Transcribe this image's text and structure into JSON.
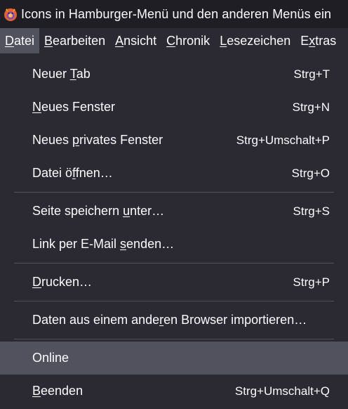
{
  "window": {
    "title": "Icons in Hamburger-Menü und den anderen Menüs ein"
  },
  "menubar": {
    "items": [
      {
        "pre": "",
        "ul": "D",
        "post": "atei",
        "active": true
      },
      {
        "pre": "",
        "ul": "B",
        "post": "earbeiten",
        "active": false
      },
      {
        "pre": "",
        "ul": "A",
        "post": "nsicht",
        "active": false
      },
      {
        "pre": "",
        "ul": "C",
        "post": "hronik",
        "active": false
      },
      {
        "pre": "",
        "ul": "L",
        "post": "esezeichen",
        "active": false
      },
      {
        "pre": "E",
        "ul": "x",
        "post": "tras",
        "active": false
      }
    ]
  },
  "menu": {
    "items": [
      {
        "pre": "Neuer ",
        "ul": "T",
        "post": "ab",
        "shortcut": "Strg+T"
      },
      {
        "pre": "",
        "ul": "N",
        "post": "eues Fenster",
        "shortcut": "Strg+N"
      },
      {
        "pre": "Neues ",
        "ul": "p",
        "post": "rivates Fenster",
        "shortcut": "Strg+Umschalt+P"
      },
      {
        "pre": "Datei ö",
        "ul": "f",
        "post": "fnen…",
        "shortcut": "Strg+O"
      },
      {
        "pre": "Seite speichern ",
        "ul": "u",
        "post": "nter…",
        "shortcut": "Strg+S"
      },
      {
        "pre": "Link per E-Mail ",
        "ul": "s",
        "post": "enden…",
        "shortcut": ""
      },
      {
        "pre": "",
        "ul": "D",
        "post": "rucken…",
        "shortcut": "Strg+P"
      },
      {
        "pre": "Daten aus einem ande",
        "ul": "r",
        "post": "en Browser importieren…",
        "shortcut": ""
      },
      {
        "pre": "",
        "ul": "",
        "post": "Online",
        "shortcut": ""
      },
      {
        "pre": "",
        "ul": "B",
        "post": "eenden",
        "shortcut": "Strg+Umschalt+Q"
      }
    ]
  },
  "colors": {
    "background": "#2b2a33",
    "highlight": "#52525e",
    "text": "#fbfbfe",
    "separator": "#52525e"
  },
  "icons": {
    "app": "firefox-logo-icon"
  }
}
